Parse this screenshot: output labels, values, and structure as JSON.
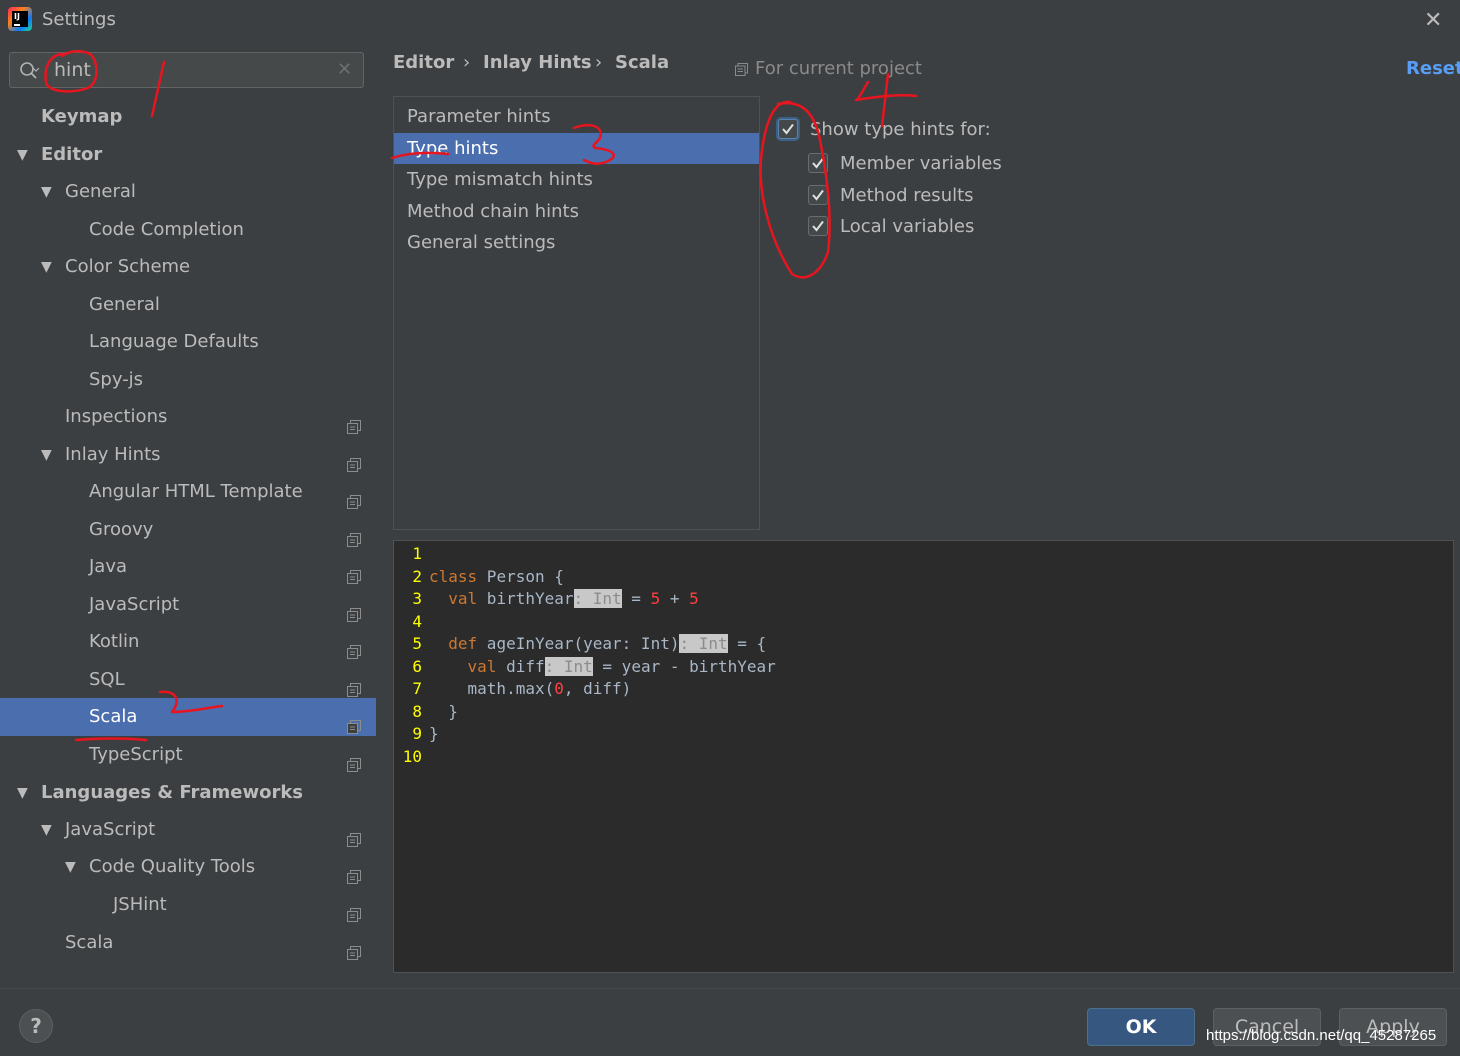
{
  "window": {
    "title": "Settings",
    "icon_text": "IJ"
  },
  "search": {
    "value": "hint",
    "placeholder": ""
  },
  "tree": [
    {
      "label": "Keymap",
      "bold": true,
      "indent": 0,
      "expanded": null,
      "copy": false,
      "selected": false
    },
    {
      "label": "Editor",
      "bold": true,
      "indent": 0,
      "expanded": true,
      "copy": false,
      "selected": false
    },
    {
      "label": "General",
      "bold": false,
      "indent": 1,
      "expanded": true,
      "copy": false,
      "selected": false
    },
    {
      "label": "Code Completion",
      "bold": false,
      "indent": 2,
      "expanded": null,
      "copy": false,
      "selected": false
    },
    {
      "label": "Color Scheme",
      "bold": false,
      "indent": 1,
      "expanded": true,
      "copy": false,
      "selected": false
    },
    {
      "label": "General",
      "bold": false,
      "indent": 2,
      "expanded": null,
      "copy": false,
      "selected": false
    },
    {
      "label": "Language Defaults",
      "bold": false,
      "indent": 2,
      "expanded": null,
      "copy": false,
      "selected": false
    },
    {
      "label": "Spy-js",
      "bold": false,
      "indent": 2,
      "expanded": null,
      "copy": false,
      "selected": false
    },
    {
      "label": "Inspections",
      "bold": false,
      "indent": 1,
      "expanded": null,
      "copy": true,
      "selected": false
    },
    {
      "label": "Inlay Hints",
      "bold": false,
      "indent": 1,
      "expanded": true,
      "copy": true,
      "selected": false
    },
    {
      "label": "Angular HTML Template",
      "bold": false,
      "indent": 2,
      "expanded": null,
      "copy": true,
      "selected": false
    },
    {
      "label": "Groovy",
      "bold": false,
      "indent": 2,
      "expanded": null,
      "copy": true,
      "selected": false
    },
    {
      "label": "Java",
      "bold": false,
      "indent": 2,
      "expanded": null,
      "copy": true,
      "selected": false
    },
    {
      "label": "JavaScript",
      "bold": false,
      "indent": 2,
      "expanded": null,
      "copy": true,
      "selected": false
    },
    {
      "label": "Kotlin",
      "bold": false,
      "indent": 2,
      "expanded": null,
      "copy": true,
      "selected": false
    },
    {
      "label": "SQL",
      "bold": false,
      "indent": 2,
      "expanded": null,
      "copy": true,
      "selected": false
    },
    {
      "label": "Scala",
      "bold": false,
      "indent": 2,
      "expanded": null,
      "copy": true,
      "selected": true
    },
    {
      "label": "TypeScript",
      "bold": false,
      "indent": 2,
      "expanded": null,
      "copy": true,
      "selected": false
    },
    {
      "label": "Languages & Frameworks",
      "bold": true,
      "indent": 0,
      "expanded": true,
      "copy": false,
      "selected": false
    },
    {
      "label": "JavaScript",
      "bold": false,
      "indent": 1,
      "expanded": true,
      "copy": true,
      "selected": false
    },
    {
      "label": "Code Quality Tools",
      "bold": false,
      "indent": 2,
      "expanded": true,
      "copy": true,
      "selected": false
    },
    {
      "label": "JSHint",
      "bold": false,
      "indent": 3,
      "expanded": null,
      "copy": true,
      "selected": false
    },
    {
      "label": "Scala",
      "bold": false,
      "indent": 1,
      "expanded": null,
      "copy": true,
      "selected": false
    }
  ],
  "breadcrumb": {
    "items": [
      "Editor",
      "Inlay Hints",
      "Scala"
    ],
    "separator": "›"
  },
  "scope": {
    "label": "For current project"
  },
  "reset": {
    "label": "Reset"
  },
  "hint_list": [
    {
      "label": "Parameter hints",
      "selected": false
    },
    {
      "label": "Type hints",
      "selected": true
    },
    {
      "label": "Type mismatch hints",
      "selected": false
    },
    {
      "label": "Method chain hints",
      "selected": false
    },
    {
      "label": "General settings",
      "selected": false
    }
  ],
  "options": {
    "main": {
      "label": "Show type hints for:",
      "checked": true
    },
    "sub": [
      {
        "label": "Member variables",
        "checked": true
      },
      {
        "label": "Method results",
        "checked": true
      },
      {
        "label": "Local variables",
        "checked": true
      }
    ]
  },
  "code": {
    "lines": [
      {
        "n": "1",
        "parts": []
      },
      {
        "n": "2",
        "parts": [
          [
            "kw",
            "class"
          ],
          [
            "t",
            " Person {"
          ]
        ]
      },
      {
        "n": "3",
        "parts": [
          [
            "t",
            "  "
          ],
          [
            "kw",
            "val"
          ],
          [
            "t",
            " birthYear"
          ],
          [
            "hl",
            ": Int"
          ],
          [
            "t",
            " = "
          ],
          [
            "num",
            "5"
          ],
          [
            "t",
            " + "
          ],
          [
            "num",
            "5"
          ]
        ]
      },
      {
        "n": "4",
        "parts": []
      },
      {
        "n": "5",
        "parts": [
          [
            "t",
            "  "
          ],
          [
            "kw",
            "def"
          ],
          [
            "t",
            " ageInYear(year: Int)"
          ],
          [
            "hl",
            ": Int"
          ],
          [
            "t",
            " = {"
          ]
        ]
      },
      {
        "n": "6",
        "parts": [
          [
            "t",
            "    "
          ],
          [
            "kw",
            "val"
          ],
          [
            "t",
            " diff"
          ],
          [
            "hl",
            ": Int"
          ],
          [
            "t",
            " = year - birthYear"
          ]
        ]
      },
      {
        "n": "7",
        "parts": [
          [
            "t",
            "    math.max("
          ],
          [
            "num",
            "0"
          ],
          [
            "t",
            ", diff)"
          ]
        ]
      },
      {
        "n": "8",
        "parts": [
          [
            "t",
            "  }"
          ]
        ]
      },
      {
        "n": "9",
        "parts": [
          [
            "t",
            "}"
          ]
        ]
      },
      {
        "n": "10",
        "parts": []
      }
    ]
  },
  "footer": {
    "help": "?",
    "ok": "OK",
    "cancel": "Cancel",
    "apply": "Apply"
  },
  "watermark": "https://blog.csdn.net/qq_45287265",
  "colors": {
    "selection": "#4b6eaf",
    "link": "#589df6",
    "annotation": "#e8141e",
    "line_number": "#ffff00"
  }
}
